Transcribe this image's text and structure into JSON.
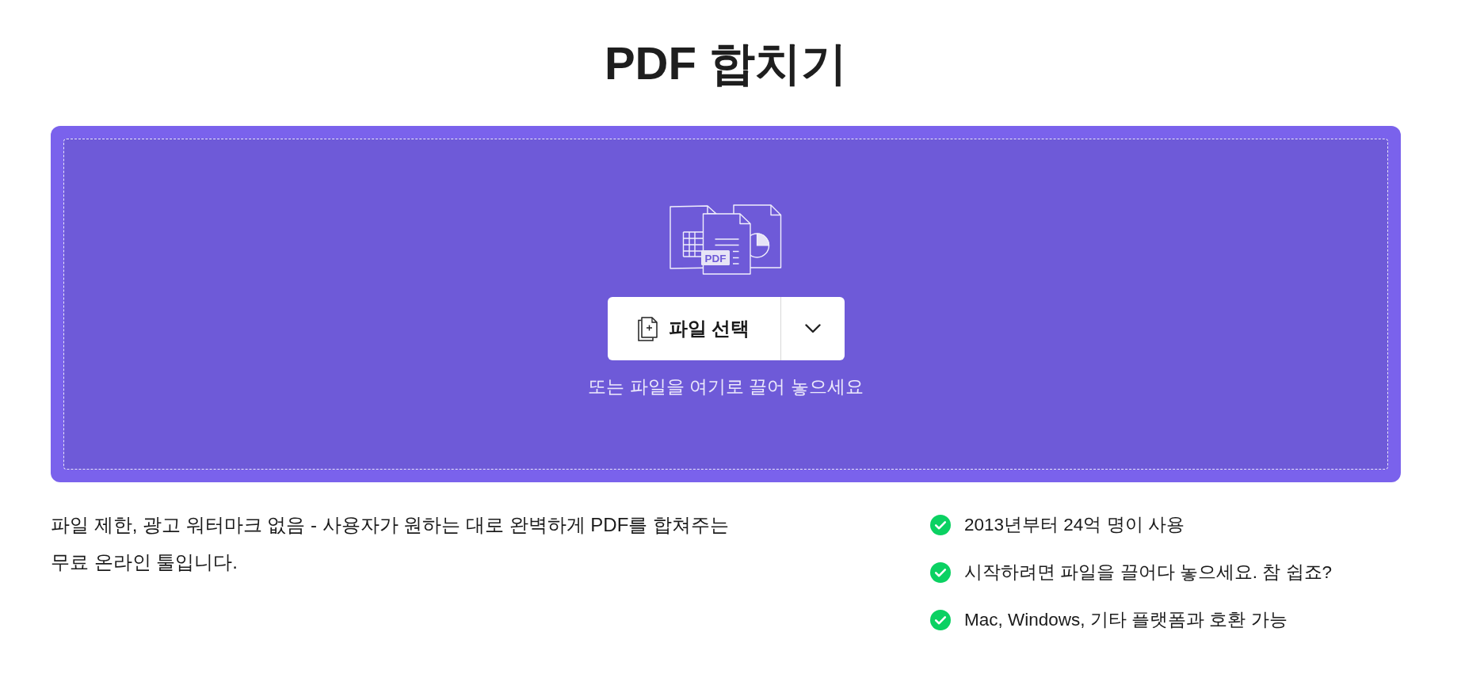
{
  "title": "PDF 합치기",
  "upload": {
    "illustration_label": "PDF",
    "button_label": "파일 선택",
    "hint": "또는 파일을 여기로 끌어 놓으세요"
  },
  "description": "파일 제한, 광고 워터마크 없음 - 사용자가 원하는 대로 완벽하게 PDF를 합쳐주는 무료 온라인 툴입니다.",
  "features": [
    "2013년부터 24억 명이 사용",
    "시작하려면 파일을 끌어다 놓으세요. 참 쉽죠?",
    "Mac, Windows, 기타 플랫폼과 호환 가능"
  ]
}
